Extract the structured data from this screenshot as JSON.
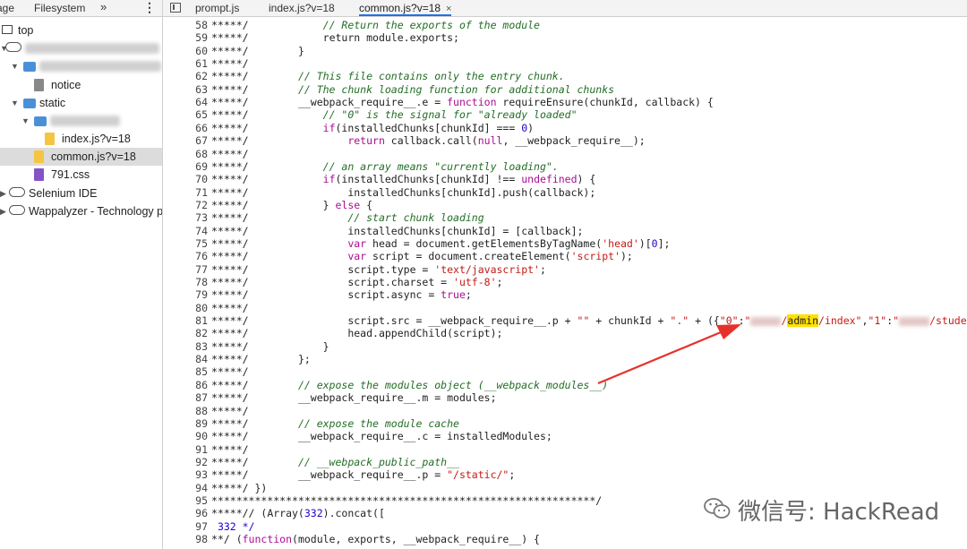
{
  "nav": {
    "tabs": {
      "page": "age",
      "filesystem": "Filesystem",
      "more": "»",
      "menu": "⋮"
    },
    "tree": {
      "top": "top",
      "notice": "notice",
      "static": "static",
      "index_js": "index.js?v=18",
      "common_js": "common.js?v=18",
      "css": "791.css",
      "selenium": "Selenium IDE",
      "wappalyzer": "Wappalyzer - Technology pr"
    }
  },
  "editor": {
    "tabs": [
      {
        "label": "prompt.js"
      },
      {
        "label": "index.js?v=18"
      },
      {
        "label": "common.js?v=18",
        "close": "×"
      }
    ]
  },
  "code": {
    "line_numbers": [
      "58",
      "59",
      "60",
      "61",
      "62",
      "63",
      "64",
      "65",
      "66",
      "67",
      "68",
      "69",
      "70",
      "71",
      "72",
      "73",
      "74",
      "75",
      "76",
      "77",
      "78",
      "79",
      "80",
      "81",
      "82",
      "83",
      "84",
      "85",
      "86",
      "87",
      "88",
      "89",
      "90",
      "91",
      "92",
      "93",
      "94",
      "95",
      "96",
      "97",
      "98"
    ],
    "prefix": "*****/",
    "rule": "**************************************************************/",
    "tokens": {
      "c58": "// Return the exports of the module",
      "c62": "// This file contains only the entry chunk.",
      "c63": "// The chunk loading function for additional chunks",
      "c65": "// \"0\" is the signal for \"already loaded\"",
      "c69": "// an array means \"currently loading\".",
      "c74": "// start chunk loading",
      "c86": "// expose the modules object (__webpack_modules__)",
      "c89": "// expose the module cache",
      "c92": "// __webpack_public_path__",
      "l59": "return module.exports;",
      "l64a": "__webpack_require__.e = ",
      "l64b": "function",
      "l64c": " requireEnsure(chunkId, callback) {",
      "l66a": "if",
      "l66b": "(installedChunks[chunkId] === ",
      "l66c": "0",
      "l66d": ")",
      "l67a": "return",
      "l67b": " callback.call(",
      "l67c": "null",
      "l67d": ", __webpack_require__);",
      "l70a": "if",
      "l70b": "(installedChunks[chunkId] !== ",
      "l70c": "undefined",
      "l70d": ") {",
      "l71": "installedChunks[chunkId].push(callback);",
      "l72a": "} ",
      "l72b": "else",
      "l72c": " {",
      "l75a": "var",
      "l75b": " head = document.getElementsByTagName(",
      "l75c": "'head'",
      "l75d": ")[",
      "l75e": "0",
      "l75f": "];",
      "l76a": "var",
      "l76b": " script = document.createElement(",
      "l76c": "'script'",
      "l76d": ");",
      "l77a": "script.type = ",
      "l77b": "'text/javascript'",
      "l77c": ";",
      "l78a": "script.charset = ",
      "l78b": "'utf-8'",
      "l78c": ";",
      "l79a": "script.async = ",
      "l79b": "true",
      "l79c": ";",
      "l81a": "script.src = __webpack_require__.p + ",
      "l81b": "\"\"",
      "l81c": " + chunkId + ",
      "l81d": "\".\"",
      "l81e": " + ({",
      "l81f": "\"0\"",
      "l81g": ":",
      "l81h": "\"",
      "l81i": "/",
      "l81j": "admin",
      "l81k": "/index\"",
      "l81l": ",",
      "l81m": "\"1\"",
      "l81n": ":",
      "l81o": "\"",
      "l81p": "/student/index\"",
      "l82": "head.appendChild(script);",
      "l87": "__webpack_require__.m = modules;",
      "l90": "__webpack_require__.c = installedModules;",
      "l93a": "__webpack_require__.p = ",
      "l93b": "\"/static/\"",
      "l93c": ";",
      "l94": "})",
      "l96a": "/ (Array(",
      "l96b": "332",
      "l96c": ").concat([",
      "l97": "332 */",
      "l98a": "**/ (",
      "l98b": "function",
      "l98c": "(module, exports, __webpack_require__) {",
      "brace_close": "}",
      "brace_close_semi": "};"
    }
  },
  "watermark": {
    "text": "微信号: HackRead",
    "icon": "wechat-icon"
  },
  "colors": {
    "comment": "#236e25",
    "keyword": "#aa0d91",
    "string": "#c41a16",
    "number": "#1c00cf",
    "arrow": "#e8302a",
    "highlight": "#ffe000"
  }
}
